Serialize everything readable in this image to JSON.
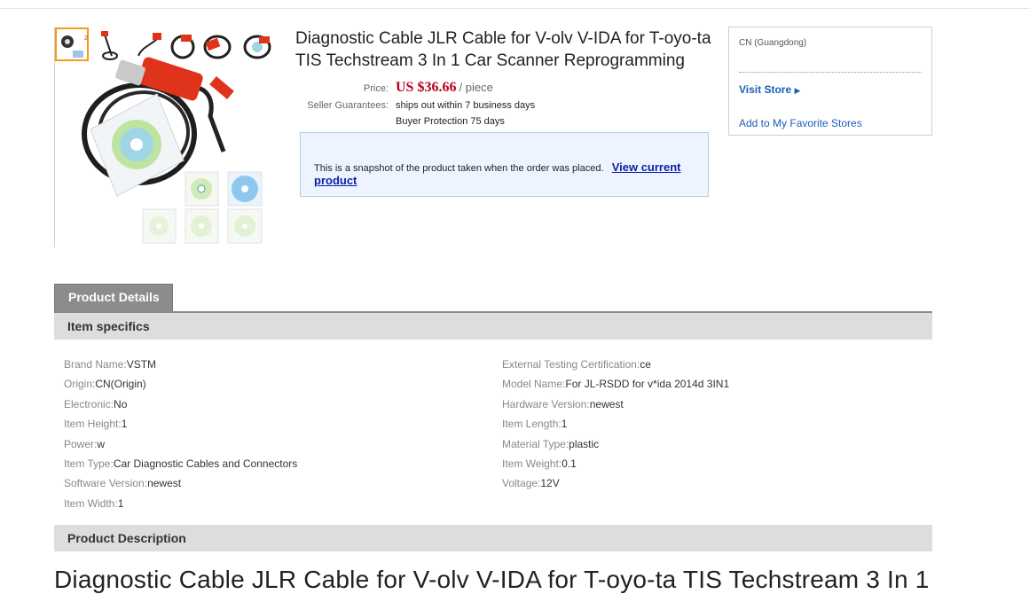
{
  "product": {
    "title": "Diagnostic Cable JLR Cable for V-olv V-IDA for T-oyo-ta TIS Techstream 3 In 1 Car Scanner Reprogramming",
    "price_label": "Price:",
    "price_value": "US $36.66",
    "price_unit": "/ piece",
    "guarantee_label": "Seller Guarantees:",
    "guarantee_1": "ships out within 7 business days",
    "guarantee_2": "Buyer Protection 75 days"
  },
  "snapshot": {
    "text": "This is a snapshot of the product taken when the order was placed.",
    "link": "View current product"
  },
  "store": {
    "location": "CN (Guangdong)",
    "visit": "Visit Store",
    "favorite": "Add to My Favorite Stores"
  },
  "tabs": {
    "product_details": "Product Details"
  },
  "sections": {
    "item_specifics": "Item specifics",
    "product_description": "Product Description"
  },
  "specs_left": [
    {
      "k": "Brand Name:",
      "v": "VSTM"
    },
    {
      "k": "Origin:",
      "v": "CN(Origin)"
    },
    {
      "k": "Electronic:",
      "v": "No"
    },
    {
      "k": "Item Height:",
      "v": "1"
    },
    {
      "k": "Power:",
      "v": "w"
    },
    {
      "k": "Item Type:",
      "v": "Car Diagnostic Cables and Connectors"
    },
    {
      "k": "Software Version:",
      "v": "newest"
    },
    {
      "k": "Item Width:",
      "v": "1"
    }
  ],
  "specs_right": [
    {
      "k": "External Testing Certification:",
      "v": "ce"
    },
    {
      "k": "Model Name:",
      "v": "For JL-RSDD for v*ida 2014d 3IN1"
    },
    {
      "k": "Hardware Version:",
      "v": "newest"
    },
    {
      "k": "Item Length:",
      "v": "1"
    },
    {
      "k": "Material Type:",
      "v": "plastic"
    },
    {
      "k": "Item Weight:",
      "v": "0.1"
    },
    {
      "k": "Voltage:",
      "v": "12V"
    }
  ],
  "description": {
    "title": "Diagnostic Cable JLR Cable for V-olv V-IDA for T-oyo-ta TIS Techstream 3 In 1"
  },
  "colors": {
    "price": "#b8001f",
    "link": "#1a5fb4",
    "tab": "#8c8c8c"
  }
}
